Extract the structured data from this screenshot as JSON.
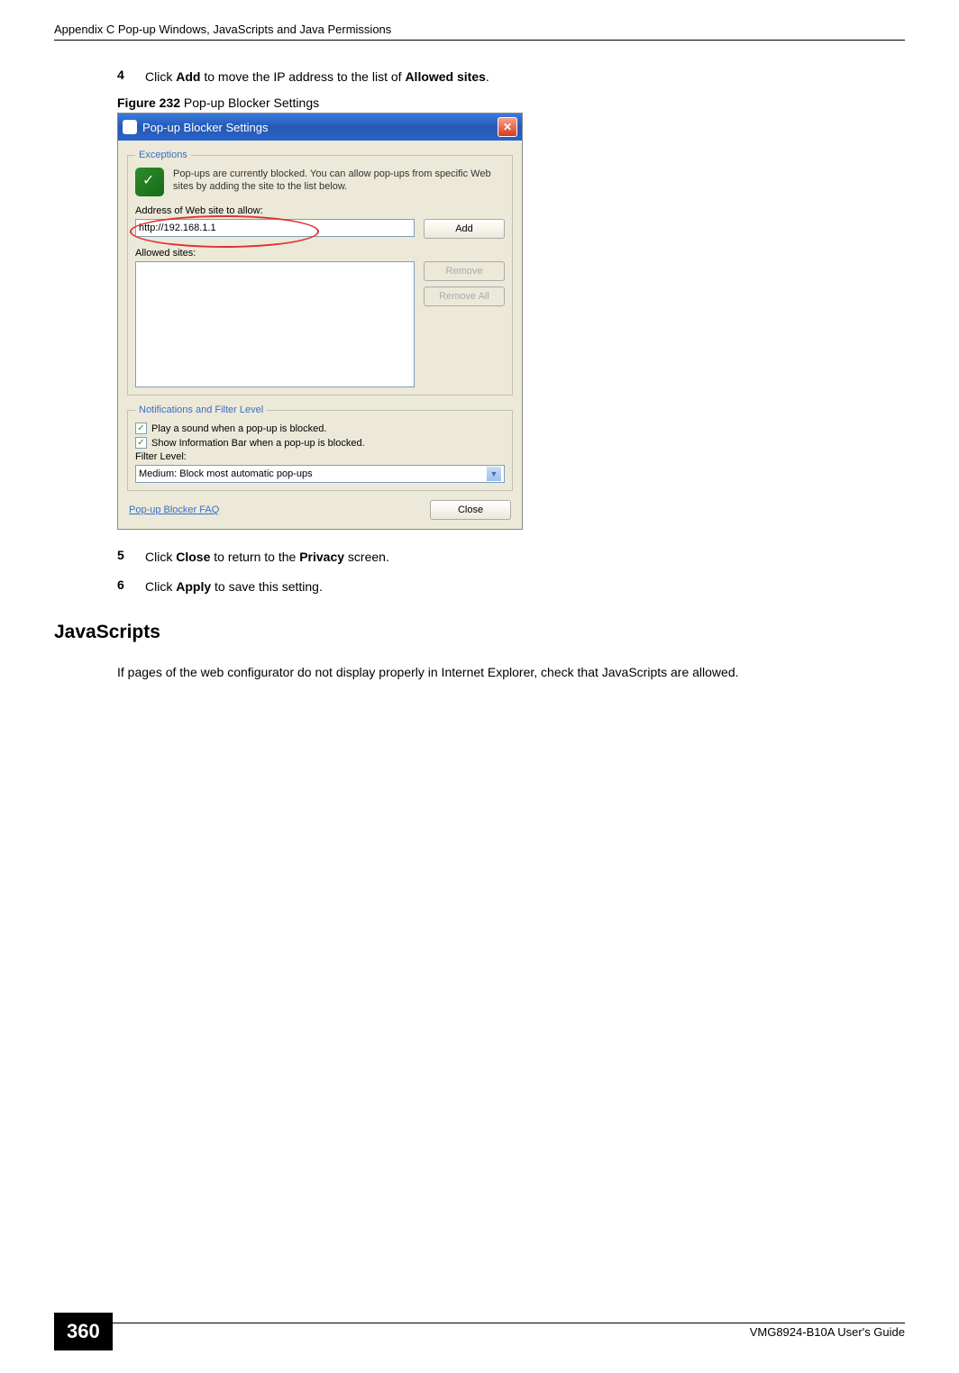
{
  "header": {
    "left": "Appendix C Pop-up Windows, JavaScripts and Java Permissions"
  },
  "steps": {
    "s4": {
      "num": "4",
      "pre": "Click ",
      "b1": "Add",
      "mid": " to move the IP address to the list of ",
      "b2": "Allowed sites",
      "post": "."
    },
    "s5": {
      "num": "5",
      "pre": "Click ",
      "b1": "Close",
      "mid": " to return to the ",
      "b2": "Privacy",
      "post": " screen."
    },
    "s6": {
      "num": "6",
      "pre": "Click ",
      "b1": "Apply",
      "post": " to save this setting."
    }
  },
  "figure": {
    "label": "Figure 232",
    "caption": "   Pop-up Blocker Settings"
  },
  "dialog": {
    "title": "Pop-up Blocker Settings",
    "exceptions_legend": "Exceptions",
    "exceptions_text": "Pop-ups are currently blocked. You can allow pop-ups from specific Web sites by adding the site to the list below.",
    "address_label": "Address of Web site to allow:",
    "address_value": "http://192.168.1.1",
    "add_btn": "Add",
    "allowed_label": "Allowed sites:",
    "remove_btn": "Remove",
    "removeall_btn": "Remove All",
    "notif_legend": "Notifications and Filter Level",
    "chk1": "Play a sound when a pop-up is blocked.",
    "chk2": "Show Information Bar when a pop-up is blocked.",
    "filter_label": "Filter Level:",
    "filter_value": "Medium: Block most automatic pop-ups",
    "faq": "Pop-up Blocker FAQ",
    "close_btn": "Close"
  },
  "section": {
    "heading": "JavaScripts",
    "para": "If pages of the web configurator do not display properly in Internet Explorer, check that JavaScripts are allowed."
  },
  "footer": {
    "page": "360",
    "guide": "VMG8924-B10A User's Guide"
  }
}
